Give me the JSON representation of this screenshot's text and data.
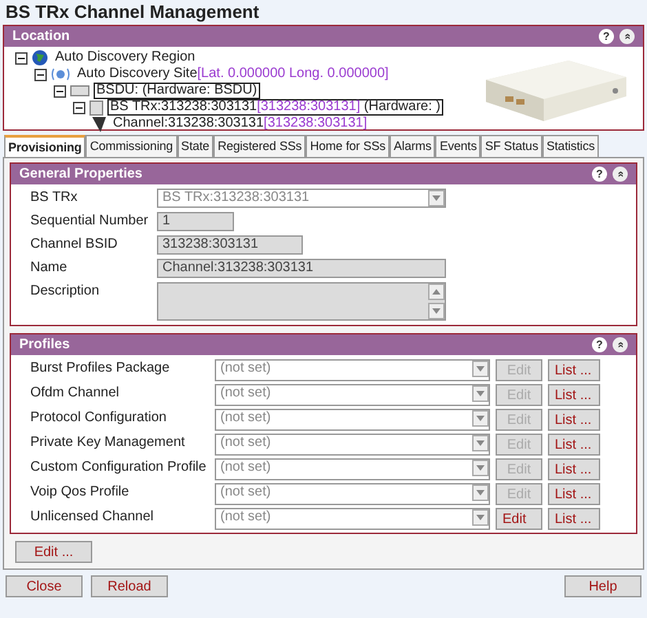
{
  "window": {
    "title": "BS TRx Channel Management"
  },
  "location": {
    "title": "Location",
    "help": "?",
    "collapse": "»",
    "tree": [
      {
        "label": "Auto Discovery Region",
        "kind": "globe",
        "expanded": true,
        "selected": false,
        "children": [
          {
            "label": "Auto Discovery Site",
            "suffix": "[Lat. 0.000000 Long. 0.000000]",
            "kind": "site",
            "expanded": true,
            "selected": false,
            "children": [
              {
                "label": "BSDU: (Hardware: BSDU)",
                "kind": "bsdu",
                "expanded": true,
                "selected": true,
                "children": [
                  {
                    "label": "BS TRx:313238:303131",
                    "suffix": "[313238:303131]",
                    "after": " (Hardware: )",
                    "kind": "trx",
                    "expanded": true,
                    "selected": true,
                    "children": [
                      {
                        "label": "Channel:313238:303131",
                        "suffix": "[313238:303131]",
                        "kind": "channel",
                        "selected": false
                      }
                    ]
                  }
                ]
              }
            ]
          }
        ]
      }
    ]
  },
  "tabs": [
    {
      "label": "Provisioning",
      "selected": true
    },
    {
      "label": "Commissioning",
      "selected": false
    },
    {
      "label": "State",
      "selected": false
    },
    {
      "label": "Registered SSs",
      "selected": false
    },
    {
      "label": "Home for SSs",
      "selected": false
    },
    {
      "label": "Alarms",
      "selected": false
    },
    {
      "label": "Events",
      "selected": false
    },
    {
      "label": "SF Status",
      "selected": false
    },
    {
      "label": "Statistics",
      "selected": false
    }
  ],
  "general": {
    "title": "General Properties",
    "help": "?",
    "collapse": "»",
    "fields": [
      {
        "label": "BS TRx",
        "value": "BS TRx:313238:303131",
        "kind": "select"
      },
      {
        "label": "Sequential Number",
        "value": "1",
        "kind": "short"
      },
      {
        "label": "Channel BSID",
        "value": "313238:303131",
        "kind": "medium"
      },
      {
        "label": "Name",
        "value": "Channel:313238:303131",
        "kind": "long"
      },
      {
        "label": "Description",
        "kind": "textarea"
      }
    ]
  },
  "profiles": {
    "title": "Profiles",
    "help": "?",
    "collapse": "»",
    "rows": [
      {
        "label": "Burst Profiles Package",
        "value": "(not set)",
        "edit": "Edit",
        "edit_disabled": true,
        "list": "List ..."
      },
      {
        "label": "Ofdm Channel",
        "value": "(not set)",
        "edit": "Edit",
        "edit_disabled": true,
        "list": "List ..."
      },
      {
        "label": "Protocol Configuration",
        "value": "(not set)",
        "edit": "Edit",
        "edit_disabled": true,
        "list": "List ..."
      },
      {
        "label": "Private Key Management",
        "value": "(not set)",
        "edit": "Edit",
        "edit_disabled": true,
        "list": "List ..."
      },
      {
        "label": "Custom Configuration Profile",
        "value": "(not set)",
        "edit": "Edit",
        "edit_disabled": true,
        "list": "List ..."
      },
      {
        "label": "Voip Qos Profile",
        "value": "(not set)",
        "edit": "Edit",
        "edit_disabled": true,
        "list": "List ..."
      },
      {
        "label": "Unlicensed Channel",
        "value": "(not set)",
        "edit": "Edit",
        "edit_disabled": false,
        "list": "List ..."
      }
    ]
  },
  "edit_button": "Edit ...",
  "footer": {
    "left": [
      "Close",
      "Reload"
    ],
    "right": [
      "Help"
    ]
  }
}
